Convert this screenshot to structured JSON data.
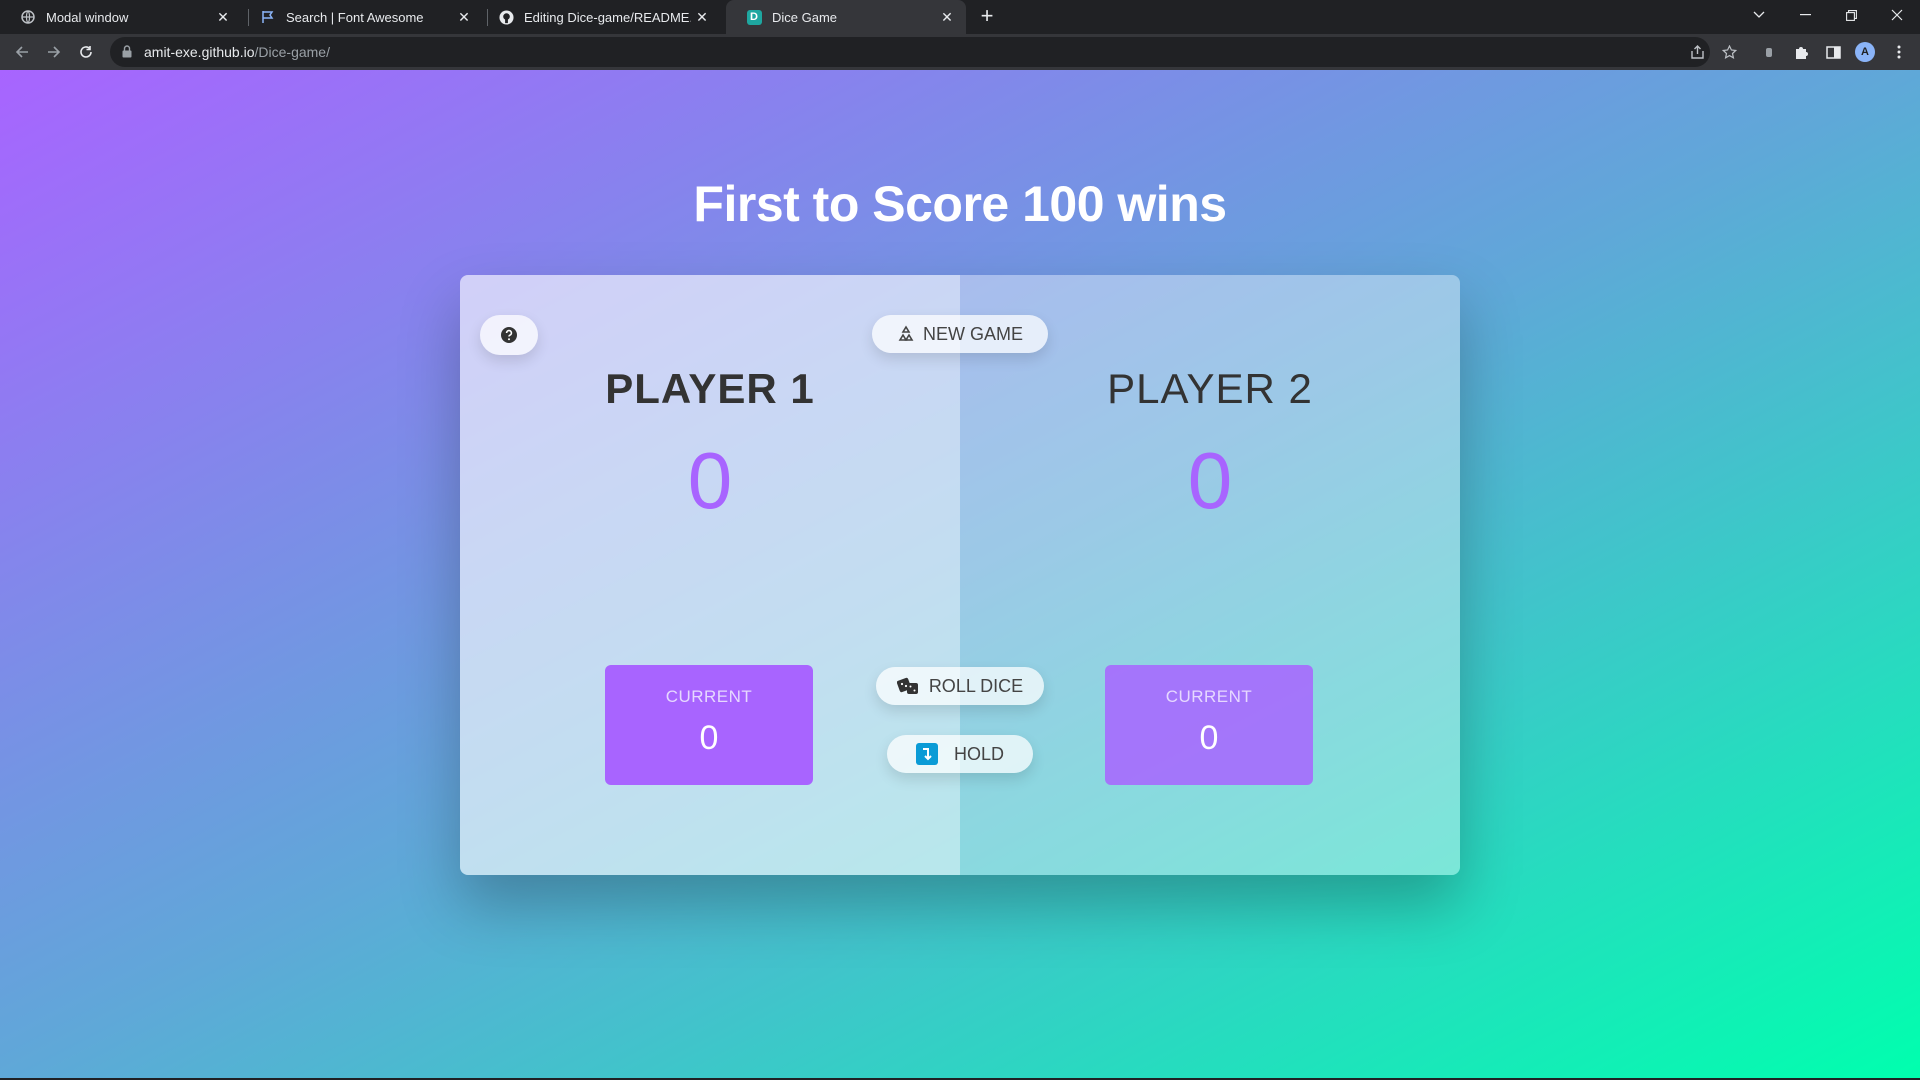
{
  "browser": {
    "tabs": [
      {
        "title": "Modal window",
        "icon": "globe-icon",
        "active": false
      },
      {
        "title": "Search | Font Awesome",
        "icon": "flag-icon",
        "active": false
      },
      {
        "title": "Editing Dice-game/README.md",
        "icon": "github-icon",
        "active": false
      },
      {
        "title": "Dice Game",
        "icon": "dice-game-favicon",
        "active": true
      }
    ],
    "favicon_letter": "D",
    "url_host": "amit-exe.github.io",
    "url_path": "/Dice-game/",
    "avatar_letter": "A"
  },
  "game": {
    "headline": "First to Score 100 wins",
    "new_game_label": "NEW GAME",
    "roll_dice_label": "ROLL DICE",
    "hold_label": "HOLD",
    "players": [
      {
        "name": "PLAYER 1",
        "score": "0",
        "current_label": "CURRENT",
        "current_score": "0",
        "active": true
      },
      {
        "name": "PLAYER 2",
        "score": "0",
        "current_label": "CURRENT",
        "current_score": "0",
        "active": false
      }
    ]
  },
  "colors": {
    "accent": "#a864ff",
    "gradient_start": "#a864ff",
    "gradient_end": "#00ffae"
  }
}
